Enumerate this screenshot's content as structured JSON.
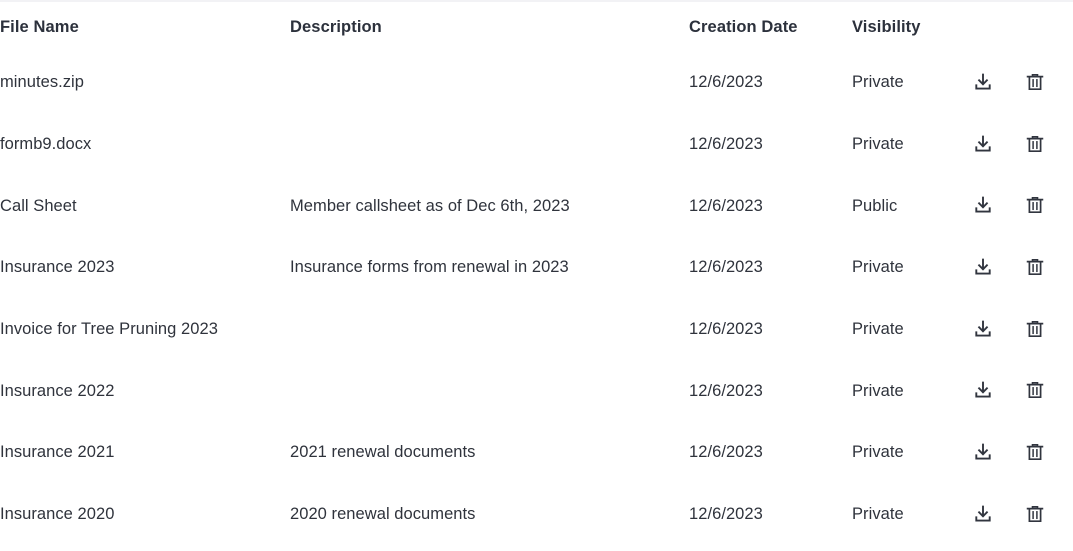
{
  "table": {
    "columns": [
      {
        "key": "file_name",
        "label": "File Name"
      },
      {
        "key": "description",
        "label": "Description"
      },
      {
        "key": "creation_date",
        "label": "Creation Date"
      },
      {
        "key": "visibility",
        "label": "Visibility"
      },
      {
        "key": "download",
        "label": ""
      },
      {
        "key": "delete",
        "label": ""
      }
    ],
    "rows": [
      {
        "file_name": "minutes.zip",
        "description": "",
        "creation_date": "12/6/2023",
        "visibility": "Private",
        "download_icon": "download-icon",
        "delete_icon": "trash-icon"
      },
      {
        "file_name": "formb9.docx",
        "description": "",
        "creation_date": "12/6/2023",
        "visibility": "Private",
        "download_icon": "download-icon",
        "delete_icon": "trash-icon"
      },
      {
        "file_name": "Call Sheet",
        "description": "Member callsheet as of Dec 6th, 2023",
        "creation_date": "12/6/2023",
        "visibility": "Public",
        "download_icon": "download-icon",
        "delete_icon": "trash-icon"
      },
      {
        "file_name": "Insurance 2023",
        "description": "Insurance forms from renewal in 2023",
        "creation_date": "12/6/2023",
        "visibility": "Private",
        "download_icon": "download-icon",
        "delete_icon": "trash-icon"
      },
      {
        "file_name": "Invoice for Tree Pruning 2023",
        "description": "",
        "creation_date": "12/6/2023",
        "visibility": "Private",
        "download_icon": "download-icon",
        "delete_icon": "trash-icon"
      },
      {
        "file_name": "Insurance 2022",
        "description": "",
        "creation_date": "12/6/2023",
        "visibility": "Private",
        "download_icon": "download-icon",
        "delete_icon": "trash-icon"
      },
      {
        "file_name": "Insurance 2021",
        "description": "2021 renewal documents",
        "creation_date": "12/6/2023",
        "visibility": "Private",
        "download_icon": "download-icon",
        "delete_icon": "trash-icon"
      },
      {
        "file_name": "Insurance 2020",
        "description": "2020 renewal documents",
        "creation_date": "12/6/2023",
        "visibility": "Private",
        "download_icon": "download-icon",
        "delete_icon": "trash-icon"
      }
    ]
  },
  "colors": {
    "text": "#2f333c",
    "header_text": "#2c313c",
    "icon": "#31353f",
    "background": "#ffffff",
    "top_border": "#f2f2f5"
  }
}
